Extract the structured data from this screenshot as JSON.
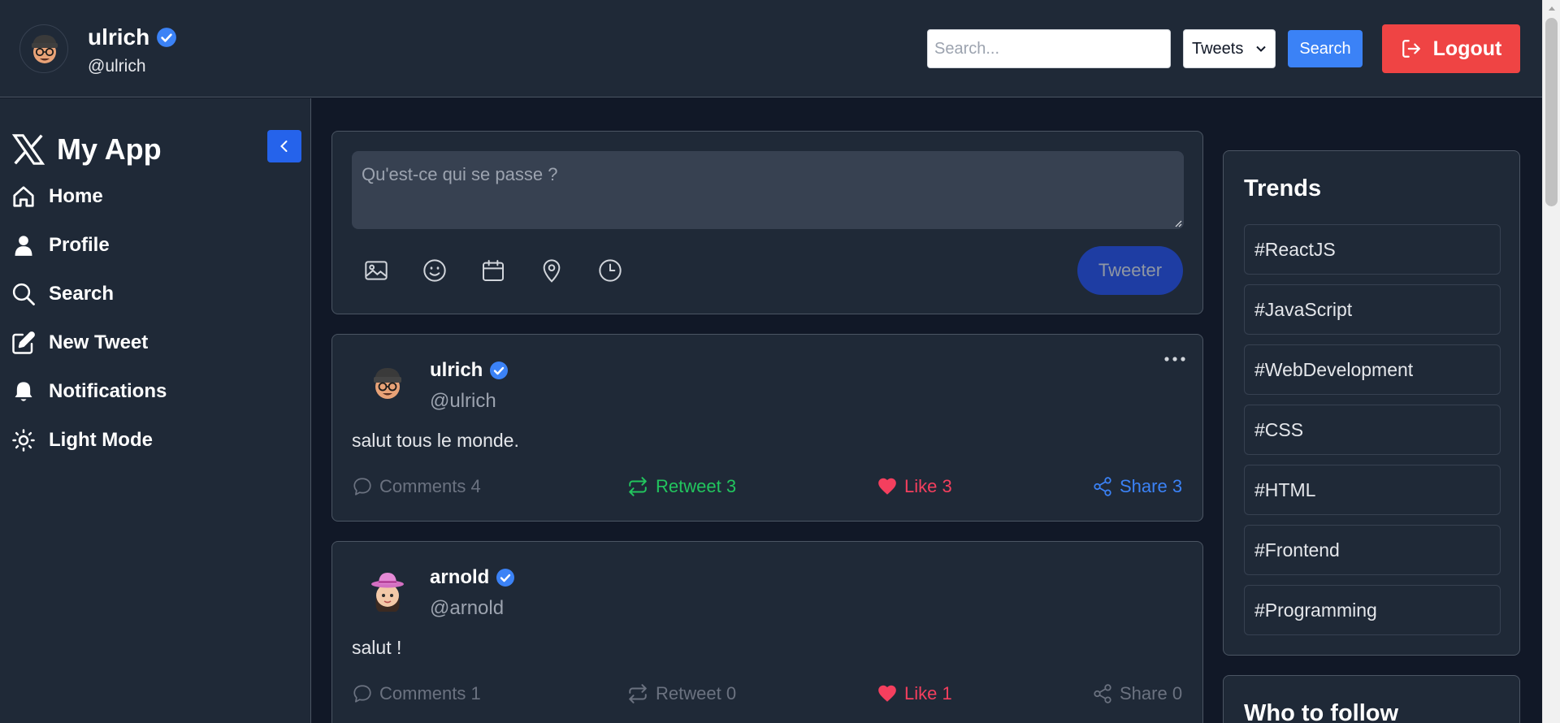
{
  "header": {
    "user": {
      "name": "ulrich",
      "handle": "@ulrich",
      "verified": true
    },
    "search": {
      "placeholder": "Search...",
      "value": ""
    },
    "filter": {
      "selected": "Tweets"
    },
    "search_button": "Search",
    "logout_button": "Logout",
    "colors": {
      "logout": "#ef4444",
      "search": "#3b82f6",
      "verified": "#3b82f6"
    }
  },
  "sidebar": {
    "brand": "My App",
    "brand_icon": "x-logo-icon",
    "collapse_icon": "chevron-left-icon",
    "items": [
      {
        "label": "Home",
        "icon": "home-icon"
      },
      {
        "label": "Profile",
        "icon": "user-icon"
      },
      {
        "label": "Search",
        "icon": "search-icon"
      },
      {
        "label": "New Tweet",
        "icon": "edit-icon"
      },
      {
        "label": "Notifications",
        "icon": "bell-icon"
      },
      {
        "label": "Light Mode",
        "icon": "sun-icon"
      }
    ]
  },
  "composer": {
    "placeholder": "Qu'est-ce qui se passe ?",
    "tools": [
      "image-icon",
      "emoji-icon",
      "calendar-icon",
      "location-icon",
      "clock-icon"
    ],
    "submit": "Tweeter"
  },
  "posts": [
    {
      "name": "ulrich",
      "handle": "@ulrich",
      "verified": true,
      "text": "salut tous le monde.",
      "comments": "Comments 4",
      "retweets": "Retweet 3",
      "likes": "Like 3",
      "shares": "Share 3",
      "retweeted": true,
      "liked": true,
      "shared": true
    },
    {
      "name": "arnold",
      "handle": "@arnold",
      "verified": true,
      "text": "salut !",
      "comments": "Comments 1",
      "retweets": "Retweet 0",
      "likes": "Like 1",
      "shares": "Share 0",
      "retweeted": false,
      "liked": true,
      "shared": false
    }
  ],
  "trends": {
    "title": "Trends",
    "items": [
      "#ReactJS",
      "#JavaScript",
      "#WebDevelopment",
      "#CSS",
      "#HTML",
      "#Frontend",
      "#Programming"
    ]
  },
  "who_to_follow": {
    "title": "Who to follow"
  },
  "colors": {
    "background": "#111827",
    "panel": "#1f2937",
    "retweet_active": "#22c55e",
    "like_active": "#f43f5e",
    "share_active": "#3b82f6",
    "muted": "#6b7280"
  }
}
